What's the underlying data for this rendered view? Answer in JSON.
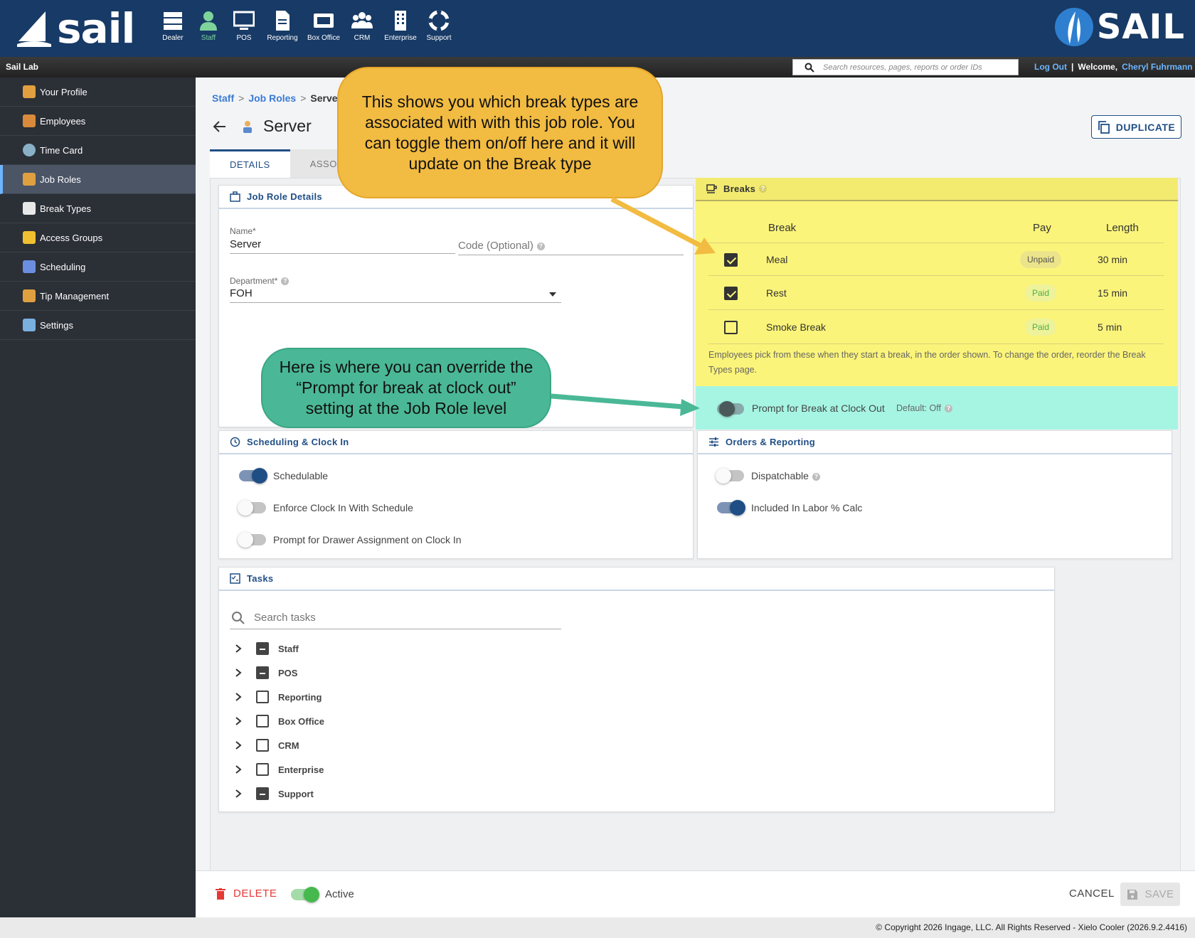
{
  "topbar": {
    "logo_text": "sail",
    "brand_text": "SAIL",
    "nav": [
      {
        "label": "Dealer"
      },
      {
        "label": "Staff"
      },
      {
        "label": "POS"
      },
      {
        "label": "Reporting"
      },
      {
        "label": "Box Office"
      },
      {
        "label": "CRM"
      },
      {
        "label": "Enterprise"
      },
      {
        "label": "Support"
      }
    ]
  },
  "subbar": {
    "site_name": "Sail Lab",
    "search_placeholder": "Search resources, pages, reports or order IDs",
    "logout": "Log Out",
    "separator": "|",
    "welcome": "Welcome,",
    "user": "Cheryl Fuhrmann"
  },
  "sidebar": {
    "items": [
      {
        "label": "Your Profile",
        "color": "#e0a040"
      },
      {
        "label": "Employees",
        "color": "#d98a3a"
      },
      {
        "label": "Time Card",
        "color": "#8ab0c8"
      },
      {
        "label": "Job Roles",
        "color": "#e0a040"
      },
      {
        "label": "Break Types",
        "color": "#e8e8e8"
      },
      {
        "label": "Access Groups",
        "color": "#f0c030"
      },
      {
        "label": "Scheduling",
        "color": "#6b8ee0"
      },
      {
        "label": "Tip Management",
        "color": "#e0a040"
      },
      {
        "label": "Settings",
        "color": "#7ab0e0"
      }
    ]
  },
  "breadcrumb": {
    "items": [
      "Staff",
      "Job Roles",
      "Server"
    ],
    "sep": ">"
  },
  "page": {
    "title": "Server",
    "duplicate": "DUPLICATE"
  },
  "tabs": [
    "DETAILS",
    "ASSOC"
  ],
  "job_role_details": {
    "title": "Job Role Details",
    "name_label": "Name*",
    "name_value": "Server",
    "code_placeholder": "Code (Optional)",
    "department_label": "Department*",
    "department_value": "FOH"
  },
  "breaks": {
    "title": "Breaks",
    "headers": {
      "break": "Break",
      "pay": "Pay",
      "length": "Length"
    },
    "rows": [
      {
        "name": "Meal",
        "pay": "Unpaid",
        "length": "30 min",
        "checked": true
      },
      {
        "name": "Rest",
        "pay": "Paid",
        "length": "15 min",
        "checked": true
      },
      {
        "name": "Smoke Break",
        "pay": "Paid",
        "length": "5 min",
        "checked": false
      }
    ],
    "note": "Employees pick from these when they start a break, in the order shown. To change the order, reorder the Break Types page.",
    "prompt_label": "Prompt for Break at Clock Out",
    "prompt_default": "Default: Off"
  },
  "scheduling": {
    "title": "Scheduling & Clock In",
    "toggles": [
      {
        "label": "Schedulable",
        "on": true
      },
      {
        "label": "Enforce Clock In With Schedule",
        "on": false
      },
      {
        "label": "Prompt for Drawer Assignment on Clock In",
        "on": false
      }
    ]
  },
  "orders": {
    "title": "Orders & Reporting",
    "toggles": [
      {
        "label": "Dispatchable",
        "on": false
      },
      {
        "label": "Included In Labor % Calc",
        "on": true
      }
    ]
  },
  "tasks": {
    "title": "Tasks",
    "search_placeholder": "Search tasks",
    "items": [
      {
        "label": "Staff",
        "state": "indeterminate"
      },
      {
        "label": "POS",
        "state": "indeterminate"
      },
      {
        "label": "Reporting",
        "state": "unchecked"
      },
      {
        "label": "Box Office",
        "state": "unchecked"
      },
      {
        "label": "CRM",
        "state": "unchecked"
      },
      {
        "label": "Enterprise",
        "state": "unchecked"
      },
      {
        "label": "Support",
        "state": "indeterminate"
      }
    ]
  },
  "actions": {
    "delete": "DELETE",
    "active": "Active",
    "cancel": "CANCEL",
    "save": "SAVE"
  },
  "footer": {
    "copyright": "© Copyright 2026 Ingage, LLC. All Rights Reserved - Xielo Cooler (2026.9.2.4416)"
  },
  "callouts": {
    "yellow": "This shows you which break types are associated with with this job role. You can toggle them on/off here and it will update on the Break type",
    "green": "Here is where you can override the “Prompt for break at clock out” setting at the Job Role level"
  },
  "colors": {
    "primary": "#173a66",
    "accent": "#1f4e85",
    "highlight_yellow": "#fbf47a",
    "highlight_teal": "#a6f5e3",
    "callout_yellow": "#f2bb41",
    "callout_green": "#4ab896"
  }
}
